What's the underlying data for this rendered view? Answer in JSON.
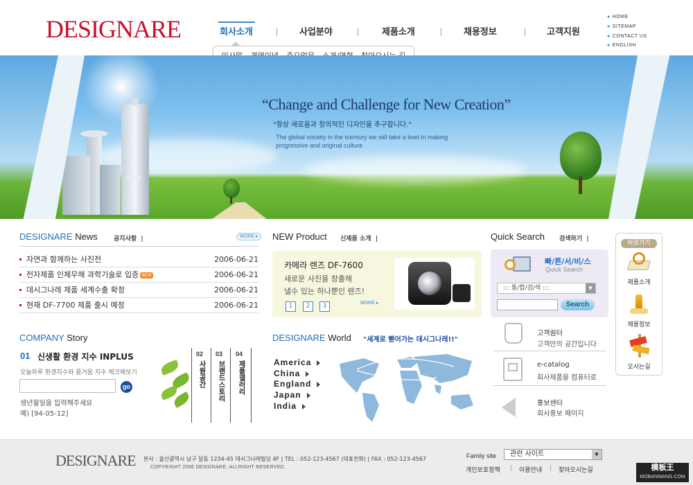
{
  "header": {
    "logo_main": "DESIGNARE",
    "nav": [
      "회사소개",
      "사업분야",
      "제품소개",
      "채용정보",
      "고객지원"
    ],
    "subnav": [
      "인사말",
      "경영이념",
      "주요업무",
      "소개/연혁",
      "찾아오시는 길"
    ],
    "util": [
      "HOME",
      "SITEMAP",
      "CONTACT US",
      "ENGLISH"
    ]
  },
  "banner": {
    "slogan": "“Change and Challenge for New Creation”",
    "slogan_kr": "\"항상 새로움과 창의적인 디자인을 추구합니다.\"",
    "slogan_en": "The global society in the tcentury we will take a lead in making progressive and original culture"
  },
  "news": {
    "title_a": "DESIGNARE",
    "title_b": "News",
    "sub": "공지사항",
    "more": "MORE",
    "new_badge": "NEW",
    "items": [
      {
        "text": "자연과 함께하는 사진전",
        "date": "2006-06-21"
      },
      {
        "text": "전자제품 인체무해 과학기술로 입증",
        "date": "2006-06-21"
      },
      {
        "text": "데시그나레 제품 세계수출 확정",
        "date": "2006-06-21"
      },
      {
        "text": "현재 DF-7700 제품 출시 예정",
        "date": "2006-06-21"
      }
    ]
  },
  "product": {
    "title_a": "NEW",
    "title_b": "Product",
    "sub": "신제품 소개",
    "name": "카메라 렌즈 DF-7600",
    "desc1": "새로운 사진을 창출해",
    "desc2": "낼수 있는 하나뿐인 렌즈!",
    "pages": [
      "1",
      "2",
      "3"
    ],
    "more": "MORE"
  },
  "quick": {
    "title": "Quick Search",
    "sub": "검색하기",
    "kr": "빠/른/서/비/스",
    "en": "Quick Search",
    "select": "::: 통/합/검/색 :::",
    "button": "Search"
  },
  "cs": [
    {
      "title": "고객쉼터",
      "desc": "고객만의 공간입니다"
    },
    {
      "title": "e-catalog",
      "desc": "회사제품을 컴퓨터로"
    },
    {
      "title": "홍보센터",
      "desc": "회사홍보 페이지"
    }
  ],
  "quickmenu": {
    "head": "바로가기",
    "items": [
      "제품소개",
      "채용정보",
      "오시는길"
    ]
  },
  "story": {
    "title_a": "COMPANY",
    "title_b": "Story",
    "num": "01",
    "headline": "신생활 환경 지수 INPLUS",
    "desc": "오늘하루 환경지수와 즐거움 지수 체크해보기",
    "go": "go",
    "hint1": "생년월일을 입력해주세요",
    "hint2": "예) [94-05-12]",
    "tabs": [
      {
        "num": "02",
        "label": "사원공간"
      },
      {
        "num": "03",
        "label": "브랜드스토리"
      },
      {
        "num": "04",
        "label": "제품갤러리"
      }
    ]
  },
  "world": {
    "title_a": "DESIGNARE",
    "title_b": "World",
    "tagline": "\"세계로 뻗어가는 데시그나레!!\"",
    "countries": [
      "America",
      "China",
      "England",
      "Japan",
      "India"
    ]
  },
  "footer": {
    "logo": "DESIGNARE",
    "address": "본사 : 울산광역시 남구 달동 1234-45 데시그나레빌딩 4F | TEL : 052-123-4567 (대표전화) | FAX : 052-123-4567",
    "copyright": "COPYRIGHT 2006 DESIGNARE. ALLRIGHT RESERVED.",
    "family_label": "Family site",
    "family_select": "관련 사이트",
    "links": [
      "개인보호정책",
      "이용안내",
      "찾아오시는길"
    ]
  },
  "watermark": {
    "main": "模板王",
    "url": "MOBANWANG.COM"
  }
}
